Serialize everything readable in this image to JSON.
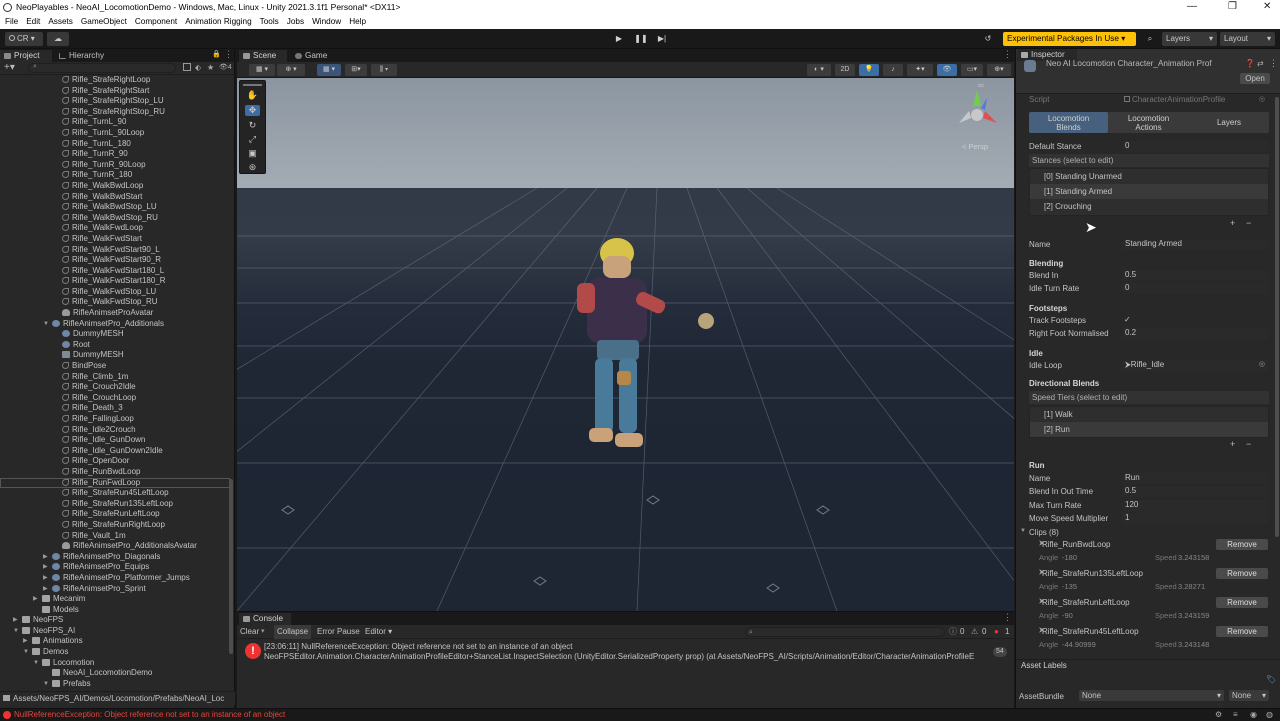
{
  "titlebar": {
    "title": "NeoPlayables - NeoAI_LocomotionDemo - Windows, Mac, Linux - Unity 2021.3.1f1 Personal* <DX11>"
  },
  "menubar": {
    "items": [
      "File",
      "Edit",
      "Assets",
      "GameObject",
      "Component",
      "Animation Rigging",
      "Tools",
      "Jobs",
      "Window",
      "Help"
    ]
  },
  "toolbar": {
    "account": "CR ▾",
    "cloud": "☁",
    "experimental": "Experimental Packages In Use ▾",
    "layers": "Layers",
    "layout": "Layout"
  },
  "leftpanel": {
    "tab_project": "Project",
    "tab_hierarchy": "Hierarchy",
    "tree": [
      {
        "label": "Rifle_StrafeRightLoop",
        "icon": "anim",
        "indent": 62
      },
      {
        "label": "Rifle_StrafeRightStart",
        "icon": "anim",
        "indent": 62
      },
      {
        "label": "Rifle_StrafeRightStop_LU",
        "icon": "anim",
        "indent": 62
      },
      {
        "label": "Rifle_StrafeRightStop_RU",
        "icon": "anim",
        "indent": 62
      },
      {
        "label": "Rifle_TurnL_90",
        "icon": "anim",
        "indent": 62
      },
      {
        "label": "Rifle_TurnL_90Loop",
        "icon": "anim",
        "indent": 62
      },
      {
        "label": "Rifle_TurnL_180",
        "icon": "anim",
        "indent": 62
      },
      {
        "label": "Rifle_TurnR_90",
        "icon": "anim",
        "indent": 62
      },
      {
        "label": "Rifle_TurnR_90Loop",
        "icon": "anim",
        "indent": 62
      },
      {
        "label": "Rifle_TurnR_180",
        "icon": "anim",
        "indent": 62
      },
      {
        "label": "Rifle_WalkBwdLoop",
        "icon": "anim",
        "indent": 62
      },
      {
        "label": "Rifle_WalkBwdStart",
        "icon": "anim",
        "indent": 62
      },
      {
        "label": "Rifle_WalkBwdStop_LU",
        "icon": "anim",
        "indent": 62
      },
      {
        "label": "Rifle_WalkBwdStop_RU",
        "icon": "anim",
        "indent": 62
      },
      {
        "label": "Rifle_WalkFwdLoop",
        "icon": "anim",
        "indent": 62
      },
      {
        "label": "Rifle_WalkFwdStart",
        "icon": "anim",
        "indent": 62
      },
      {
        "label": "Rifle_WalkFwdStart90_L",
        "icon": "anim",
        "indent": 62
      },
      {
        "label": "Rifle_WalkFwdStart90_R",
        "icon": "anim",
        "indent": 62
      },
      {
        "label": "Rifle_WalkFwdStart180_L",
        "icon": "anim",
        "indent": 62
      },
      {
        "label": "Rifle_WalkFwdStart180_R",
        "icon": "anim",
        "indent": 62
      },
      {
        "label": "Rifle_WalkFwdStop_LU",
        "icon": "anim",
        "indent": 62
      },
      {
        "label": "Rifle_WalkFwdStop_RU",
        "icon": "anim",
        "indent": 62
      },
      {
        "label": "RifleAnimsetProAvatar",
        "icon": "avatar",
        "indent": 62
      },
      {
        "label": "RifleAnimsetPro_Additionals",
        "icon": "model",
        "indent": 52,
        "arrow": "▼"
      },
      {
        "label": "DummyMESH",
        "icon": "model",
        "indent": 62
      },
      {
        "label": "Root",
        "icon": "model",
        "indent": 62
      },
      {
        "label": "DummyMESH",
        "icon": "mesh",
        "indent": 62
      },
      {
        "label": "BindPose",
        "icon": "anim",
        "indent": 62
      },
      {
        "label": "Rifle_Climb_1m",
        "icon": "anim",
        "indent": 62
      },
      {
        "label": "Rifle_Crouch2Idle",
        "icon": "anim",
        "indent": 62
      },
      {
        "label": "Rifle_CrouchLoop",
        "icon": "anim",
        "indent": 62
      },
      {
        "label": "Rifle_Death_3",
        "icon": "anim",
        "indent": 62
      },
      {
        "label": "Rifle_FallingLoop",
        "icon": "anim",
        "indent": 62
      },
      {
        "label": "Rifle_Idle2Crouch",
        "icon": "anim",
        "indent": 62
      },
      {
        "label": "Rifle_Idle_GunDown",
        "icon": "anim",
        "indent": 62
      },
      {
        "label": "Rifle_Idle_GunDown2Idle",
        "icon": "anim",
        "indent": 62
      },
      {
        "label": "Rifle_OpenDoor",
        "icon": "anim",
        "indent": 62
      },
      {
        "label": "Rifle_RunBwdLoop",
        "icon": "anim",
        "indent": 62
      },
      {
        "label": "Rifle_RunFwdLoop",
        "icon": "anim",
        "indent": 62,
        "hl": true
      },
      {
        "label": "Rifle_StrafeRun45LeftLoop",
        "icon": "anim",
        "indent": 62
      },
      {
        "label": "Rifle_StrafeRun135LeftLoop",
        "icon": "anim",
        "indent": 62
      },
      {
        "label": "Rifle_StrafeRunLeftLoop",
        "icon": "anim",
        "indent": 62
      },
      {
        "label": "Rifle_StrafeRunRightLoop",
        "icon": "anim",
        "indent": 62
      },
      {
        "label": "Rifle_Vault_1m",
        "icon": "anim",
        "indent": 62
      },
      {
        "label": "RifleAnimsetPro_AdditionalsAvatar",
        "icon": "avatar",
        "indent": 62
      },
      {
        "label": "RifleAnimsetPro_Diagonals",
        "icon": "model",
        "indent": 52,
        "arrow": "▶"
      },
      {
        "label": "RifleAnimsetPro_Equips",
        "icon": "model",
        "indent": 52,
        "arrow": "▶"
      },
      {
        "label": "RifleAnimsetPro_Platformer_Jumps",
        "icon": "model",
        "indent": 52,
        "arrow": "▶"
      },
      {
        "label": "RifleAnimsetPro_Sprint",
        "icon": "model",
        "indent": 52,
        "arrow": "▶"
      },
      {
        "label": "Mecanim",
        "icon": "folder",
        "indent": 42,
        "arrow": "▶"
      },
      {
        "label": "Models",
        "icon": "folder",
        "indent": 42
      },
      {
        "label": "NeoFPS",
        "icon": "folder",
        "indent": 22,
        "arrow": "▶"
      },
      {
        "label": "NeoFPS_AI",
        "icon": "folder",
        "indent": 22,
        "arrow": "▼"
      },
      {
        "label": "Animations",
        "icon": "folder",
        "indent": 32,
        "arrow": "▶"
      },
      {
        "label": "Demos",
        "icon": "folder",
        "indent": 32,
        "arrow": "▼"
      },
      {
        "label": "Locomotion",
        "icon": "folder",
        "indent": 42,
        "arrow": "▼"
      },
      {
        "label": "NeoAI_LocomotionDemo",
        "icon": "folder",
        "indent": 52
      },
      {
        "label": "Prefabs",
        "icon": "folder",
        "indent": 52,
        "arrow": "▼"
      }
    ],
    "path": "Assets/NeoFPS_AI/Demos/Locomotion/Prefabs/NeoAI_Loc"
  },
  "scene": {
    "tab_scene": "Scene",
    "tab_game": "Game",
    "mode_2d": "2D",
    "persp": "< Persp"
  },
  "console": {
    "tab": "Console",
    "clear": "Clear",
    "collapse": "Collapse",
    "error_pause": "Error Pause",
    "editor": "Editor ▾",
    "count_log": "0",
    "count_warn": "0",
    "count_err": "1",
    "msg_line1": "[23:06:11] NullReferenceException: Object reference not set to an instance of an object",
    "msg_line2": "NeoFPSEditor.Animation.CharacterAnimationProfileEditor+StanceList.InspectSelection (UnityEditor.SerializedProperty prop) (at Assets/NeoFPS_AI/Scripts/Animation/Editor/CharacterAnimationProfileE",
    "msg_count": "54"
  },
  "inspector": {
    "tab": "Inspector",
    "object_title": "Neo AI Locomotion Character_Animation Prof",
    "open": "Open",
    "script_label": "Script",
    "script_value": "CharacterAnimationProfile",
    "tabs": [
      "Locomotion\nBlends",
      "Locomotion\nActions",
      "Layers"
    ],
    "default_stance_label": "Default Stance",
    "default_stance_value": "0",
    "stances_header": "Stances (select to edit)",
    "stances": [
      "[0] Standing Unarmed",
      "[1] Standing Armed",
      "[2] Crouching"
    ],
    "name_label": "Name",
    "name_value": "Standing Armed",
    "blending": "Blending",
    "blend_in_label": "Blend In",
    "blend_in_value": "0.5",
    "idle_turn_label": "Idle Turn Rate",
    "idle_turn_value": "0",
    "footsteps": "Footsteps",
    "track_label": "Track Footsteps",
    "track_value": "✓",
    "rightfoot_label": "Right Foot Normalised",
    "rightfoot_value": "0.2",
    "idle": "Idle",
    "idle_loop_label": "Idle Loop",
    "idle_loop_value": "Rifle_Idle",
    "dirblends": "Directional Blends",
    "tiers_header": "Speed Tiers (select to edit)",
    "tiers": [
      "[1] Walk",
      "[2] Run"
    ],
    "run": "Run",
    "run_name_label": "Name",
    "run_name_value": "Run",
    "blend_io_label": "Blend In Out Time",
    "blend_io_value": "0.5",
    "max_turn_label": "Max Turn Rate",
    "max_turn_value": "120",
    "move_mult_label": "Move Speed Multiplier",
    "move_mult_value": "1",
    "clips_label": "Clips (8)",
    "remove": "Remove",
    "clips": [
      {
        "name": "Rifle_RunBwdLoop",
        "angle": "-180",
        "speed": "3.243158"
      },
      {
        "name": "Rifle_StrafeRun135LeftLoop",
        "angle": "-135",
        "speed": "3.28271"
      },
      {
        "name": "Rifle_StrafeRunLeftLoop",
        "angle": "-90",
        "speed": "3.243159"
      },
      {
        "name": "Rifle_StrafeRun45LeftLoop",
        "angle": "-44.90999",
        "speed": "3.243148"
      }
    ],
    "angle_word": "Angle",
    "speed_word": "Speed",
    "asset_labels": "Asset Labels",
    "assetbundle_label": "AssetBundle",
    "assetbundle_value": "None",
    "variant_value": "None"
  },
  "statusbar": {
    "text": "NullReferenceException: Object reference not set to an instance of an object"
  }
}
